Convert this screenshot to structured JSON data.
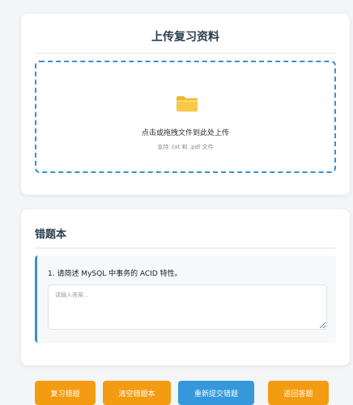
{
  "upload": {
    "title": "上传复习资料",
    "drop_text": "点击或拖拽文件到此处上传",
    "hint": "支持 .txt 和 .pdf 文件",
    "icon": "folder-icon"
  },
  "wrongbook": {
    "title": "错题本",
    "questions": [
      {
        "text": "1. 请简述 MySQL 中事务的 ACID 特性。",
        "answer_value": "",
        "answer_placeholder": "请输入答案..."
      }
    ]
  },
  "actions": {
    "review": "复习错题",
    "clear": "清空错题本",
    "resubmit": "重新提交错题",
    "back": "返回答题"
  },
  "colors": {
    "accent_blue": "#3a8fd1",
    "button_orange": "#f39c12",
    "button_blue": "#3498db",
    "folder_yellow": "#f7c948"
  }
}
